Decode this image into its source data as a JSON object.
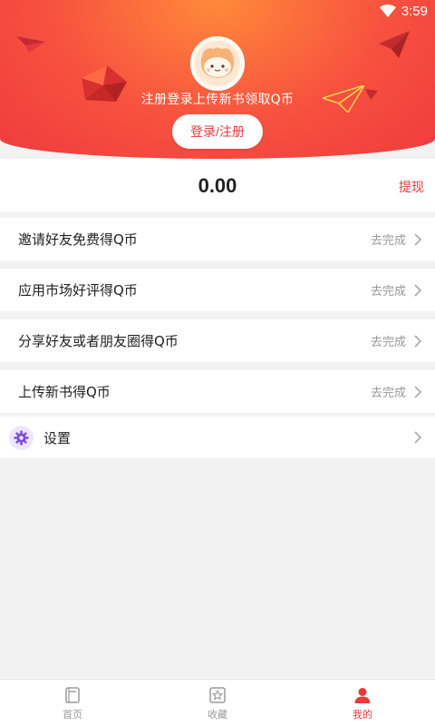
{
  "status_bar": {
    "time": "3:59",
    "wifi_icon": "wifi-icon"
  },
  "header": {
    "promo_text": "注册登录上传新书领取Q币",
    "login_button": "登录/注册",
    "avatar_icon": "cat-avatar-icon",
    "gradient_colors": [
      "#ff8a3a",
      "#f7513f",
      "#ef3b3e"
    ]
  },
  "balance": {
    "amount": "0.00",
    "withdraw_label": "提现"
  },
  "tasks": [
    {
      "label": "邀请好友免费得Q币",
      "status": "去完成"
    },
    {
      "label": "应用市场好评得Q币",
      "status": "去完成"
    },
    {
      "label": "分享好友或者朋友圈得Q币",
      "status": "去完成"
    },
    {
      "label": "上传新书得Q币",
      "status": "去完成"
    }
  ],
  "settings": {
    "label": "设置",
    "icon": "gear-icon"
  },
  "bottom_nav": [
    {
      "label": "首页",
      "icon": "book-icon",
      "active": false
    },
    {
      "label": "收藏",
      "icon": "star-icon",
      "active": false
    },
    {
      "label": "我的",
      "icon": "user-icon",
      "active": true
    }
  ],
  "colors": {
    "accent": "#e8383d",
    "settings_icon": "#7b4fd6",
    "muted": "#999999"
  }
}
